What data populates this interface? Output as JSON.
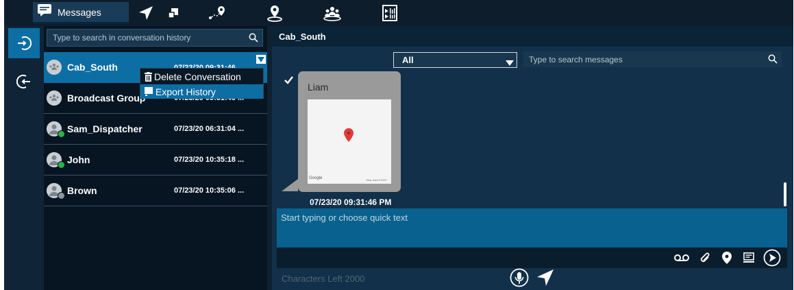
{
  "topbar": {
    "messages_tab_label": "Messages",
    "icons": [
      "messages-icon",
      "navigate-icon",
      "layers-icon",
      "route-icon",
      "location-icon",
      "group-icon",
      "media-icon"
    ]
  },
  "rail": {
    "items": [
      "login-icon",
      "logout-icon"
    ]
  },
  "conversations": {
    "search_placeholder": "Type to search in conversation history",
    "items": [
      {
        "name": "Cab_South",
        "time": "07/23/20 09:31:46",
        "type": "group",
        "selected": true
      },
      {
        "name": "Broadcast Group",
        "time": "07/23/20 09:31:46 ...",
        "type": "group",
        "selected": false
      },
      {
        "name": "Sam_Dispatcher",
        "time": "07/23/20 06:31:04 ...",
        "type": "user",
        "status": "online"
      },
      {
        "name": "John",
        "time": "07/23/20 10:35:18 ...",
        "type": "user",
        "status": "online"
      },
      {
        "name": "Brown",
        "time": "07/23/20 10:35:06 ...",
        "type": "user",
        "status": "offline"
      }
    ]
  },
  "context_menu": {
    "items": [
      {
        "label": "Delete Conversation",
        "icon": "trash-icon"
      },
      {
        "label": "Export History",
        "icon": "export-icon"
      }
    ]
  },
  "chat": {
    "title": "Cab_South",
    "filter_value": "All",
    "search_placeholder": "Type to search messages",
    "message": {
      "sender": "Liam",
      "map_logo": "Google",
      "map_data_text": "Map data ©2020",
      "time": "07/23/20 09:31:46 PM"
    },
    "compose_placeholder": "Start typing or choose quick text",
    "chars_left": "Characters Left 2000",
    "tools": [
      "voicemail-icon",
      "attach-icon",
      "location-pin-icon",
      "quick-text-icon",
      "send-circle-icon"
    ]
  },
  "colors": {
    "accent": "#0d6ea3",
    "panel": "#123049",
    "list_bg": "#071523",
    "online": "#2bb24c"
  }
}
